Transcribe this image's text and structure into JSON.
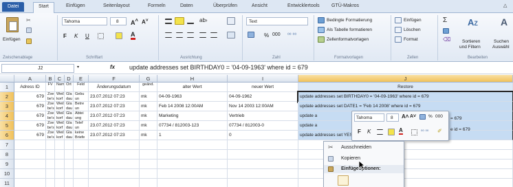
{
  "tabs": [
    "Datei",
    "Start",
    "Einfügen",
    "Seitenlayout",
    "Formeln",
    "Daten",
    "Überprüfen",
    "Ansicht",
    "Entwicklertools",
    "GTÜ-Makros"
  ],
  "ribbon": {
    "clipboard": {
      "paste": "Einfügen",
      "group": "Zwischenablage"
    },
    "font": {
      "name": "Tahoma",
      "size": "8",
      "group": "Schriftart",
      "bold": "F",
      "italic": "K",
      "underline": "U"
    },
    "align": {
      "group": "Ausrichtung"
    },
    "number": {
      "format": "Text",
      "percent": "%",
      "thousands": "000",
      "group": "Zahl"
    },
    "styles": {
      "cond": "Bedingte Formatierung",
      "table": "Als Tabelle formatieren",
      "cell": "Zellenformatvorlagen",
      "group": "Formatvorlagen"
    },
    "cells": {
      "insert": "Einfügen",
      "delete": "Löschen",
      "format": "Format",
      "group": "Zellen"
    },
    "edit": {
      "sum": "Σ",
      "sort1": "Sortieren",
      "sort2": "und Filtern",
      "find1": "Suchen",
      "find2": "Auswähl",
      "group": "Bearbeiten"
    }
  },
  "formula": {
    "namebox": "J2",
    "fx": "fx",
    "content": "update addresses set BIRTHDAY0 = '04-09-1963' where id = 679"
  },
  "columns": [
    "A",
    "B",
    "C",
    "D",
    "E",
    "F",
    "G",
    "H",
    "I",
    "J"
  ],
  "rows": [
    "1",
    "2",
    "3",
    "4",
    "5",
    "6",
    "7",
    "8",
    "9",
    "10",
    "11"
  ],
  "header": [
    "Adress ID",
    "FV",
    "Nam",
    "Ort",
    "Feld",
    "Änderungsdatum",
    "geänd.",
    "alter Wert",
    "neuer Wert",
    "Restore"
  ],
  "header_sub": [
    "",
    "Zoe",
    "Ort",
    "Gebu",
    "",
    "",
    "von",
    "",
    "",
    ""
  ],
  "data": [
    [
      "679",
      "Zoe",
      "Weiß",
      "Gla",
      "Gebu",
      "23.07.2012 07:23",
      "mk",
      "04-09-1963",
      "04-09-1962",
      "update addresses set BIRTHDAY0 = '04-09-1963' where id = 679"
    ],
    [
      "679",
      "Zoe",
      "Weiß",
      "Gla",
      "Betre",
      "23.07.2012 07:23",
      "mk",
      "Feb 14 2008 12:00AM",
      "Nov 14 2003 12:00AM",
      "update addresses set DATE1 = 'Feb 14 2008' where id = 679"
    ],
    [
      "679",
      "Zoe",
      "Weiß",
      "Gla",
      "Abtei",
      "23.07.2012 07:23",
      "mk",
      "Marketing",
      "Vertrieb",
      "update a"
    ],
    [
      "679",
      "Zoe",
      "Weiß",
      "Gla",
      "Telef",
      "23.07.2012 07:23",
      "mk",
      "07734 / 812003-123",
      "07734 / 812003-0",
      "update a"
    ],
    [
      "679",
      "Zoe",
      "Weiß",
      "Gla",
      "keine",
      "23.07.2012 07:23",
      "mk",
      "1",
      "0",
      "update addresses set YESNO23 = 1 where id = 679"
    ]
  ],
  "sub": [
    [
      "",
      "be's",
      "korf",
      "dau",
      "un"
    ],
    [
      "",
      "be's",
      "korf",
      "dau",
      "un"
    ],
    [
      "",
      "be's",
      "korf",
      "dau",
      "ung"
    ],
    [
      "",
      "be's",
      "korf",
      "dau",
      "un"
    ],
    [
      "",
      "be's",
      "korf",
      "dau",
      "Briefe"
    ]
  ],
  "minitoolbar": {
    "font": "Tahoma",
    "size": "8",
    "bold": "F",
    "italic": "K",
    "percent": "%",
    "thousands": "000",
    "right1": "= 679",
    "right2": "e id = 679"
  },
  "context": {
    "cut": "Ausschneiden",
    "copy": "Kopieren",
    "paste_opts": "Einfügeoptionen:"
  }
}
